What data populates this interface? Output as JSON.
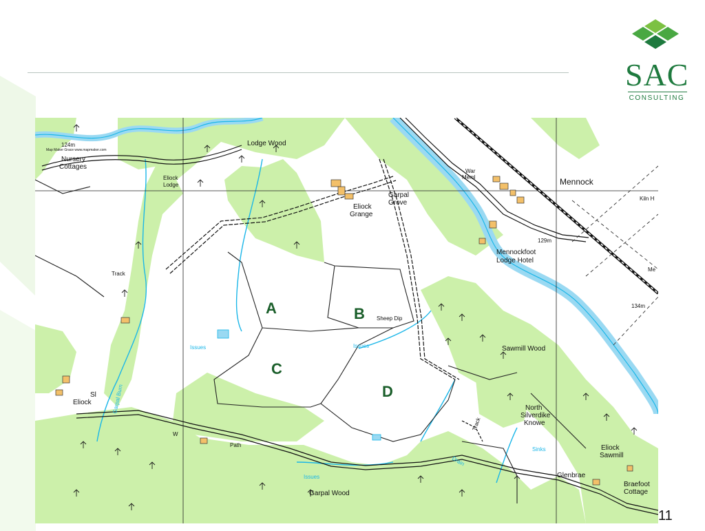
{
  "logo": {
    "main": "SAC",
    "sub": "CONSULTING"
  },
  "page": {
    "number": "11"
  },
  "map": {
    "field_labels": [
      "A",
      "B",
      "C",
      "D"
    ],
    "places": {
      "nursery": "Nursery",
      "cottages": "Cottages",
      "eliock_lodge_1": "Eliock",
      "eliock_lodge_2": "Lodge",
      "lodge_wood": "Lodge Wood",
      "eliock_grange_1": "Eliock",
      "eliock_grange_2": "Grange",
      "garpal_grove_1": "Garpal",
      "garpal_grove_2": "Grove",
      "war_meml_1": "War",
      "war_meml_2": "Meml",
      "mennock": "Mennock",
      "kiln": "Kiln H",
      "mennockfoot_1": "Mennockfoot",
      "mennockfoot_2": "Lodge Hotel",
      "me_cut": "Me",
      "sheep_dip": "Sheep Dip",
      "sawmill_wood": "Sawmill Wood",
      "north_1": "North",
      "north_2": "Silverdike",
      "north_3": "Knowe",
      "eliock_sawmill_1": "Eliock",
      "eliock_sawmill_2": "Sawmill",
      "glenbrae": "Glenbrae",
      "braefoot_1": "Braefoot",
      "braefoot_2": "Cottage",
      "garpal_wood": "Garpal Wood",
      "eliock_s": "Eliock",
      "sl": "Sl",
      "track_w": "Track",
      "track_e": "Track",
      "path": "Path",
      "w": "W"
    },
    "water": {
      "issues_w": "Issues",
      "issues_b": "Issues",
      "issues_s": "Issues",
      "sinks": "Sinks",
      "drain": "Drain",
      "garpal_burn": "Garpal Burn"
    },
    "heights": {
      "h124": "124m",
      "h129": "129m",
      "h134": "134m"
    },
    "credit": "Map Maker Grace  www.mapmaker.com",
    "colors": {
      "wood": "#ccf0aa",
      "water": "#1ab6e8",
      "road": "#111111",
      "letters": "#1a5e2a"
    }
  }
}
